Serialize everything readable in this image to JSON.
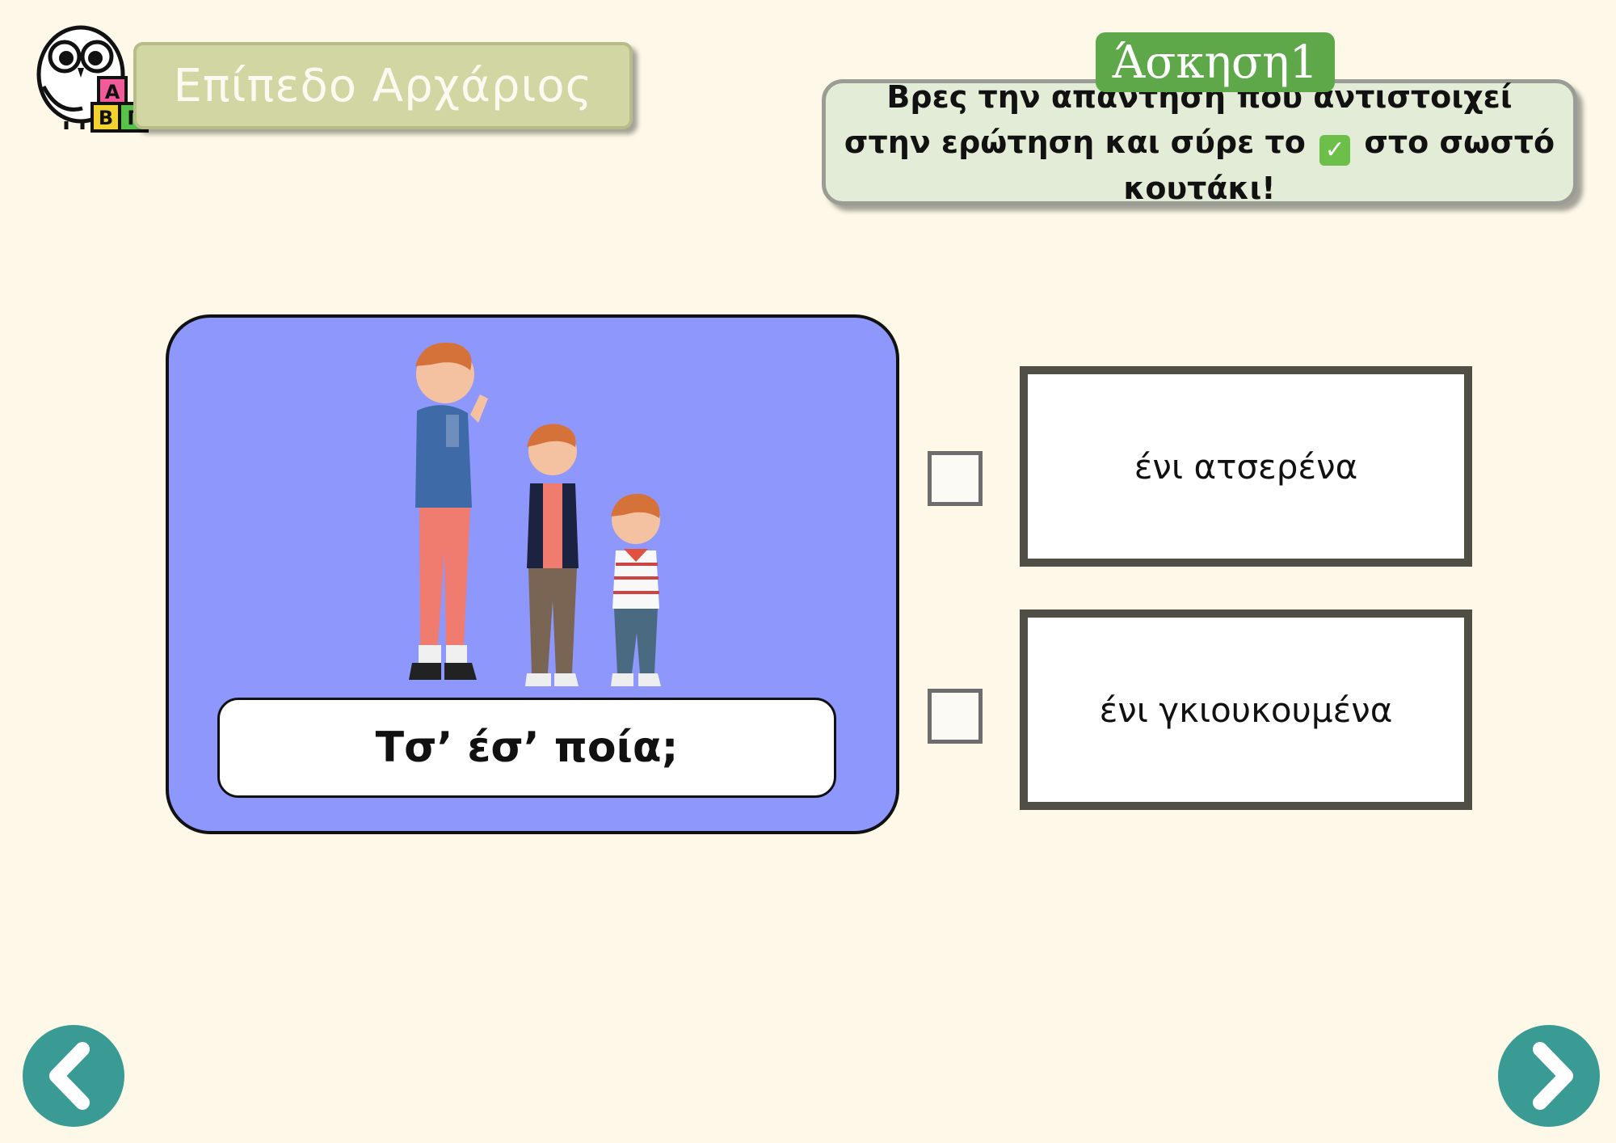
{
  "level": {
    "label": "Επίπεδο Αρχάριος"
  },
  "exercise": {
    "tag": "Άσκηση1",
    "instruction_before": "Βρες την απάντηση που αντιστοιχεί στην ερώτηση και σύρε το",
    "instruction_icon": "check-box-emoji",
    "instruction_after": "στο σωστό κουτάκι!"
  },
  "question": {
    "text": "Τσ’ έσ’ ποία;",
    "illustration": "three-brothers-illustration"
  },
  "answers": [
    {
      "label": "ένι ατσερένα"
    },
    {
      "label": "ένι γκιουκουμένα"
    }
  ],
  "nav": {
    "prev_icon": "chevron-left-icon",
    "next_icon": "chevron-right-icon"
  },
  "colors": {
    "background": "#fdf8e8",
    "card": "#8e98fc",
    "tag_green": "#5ea84a",
    "nav_teal": "#3a9a94"
  }
}
